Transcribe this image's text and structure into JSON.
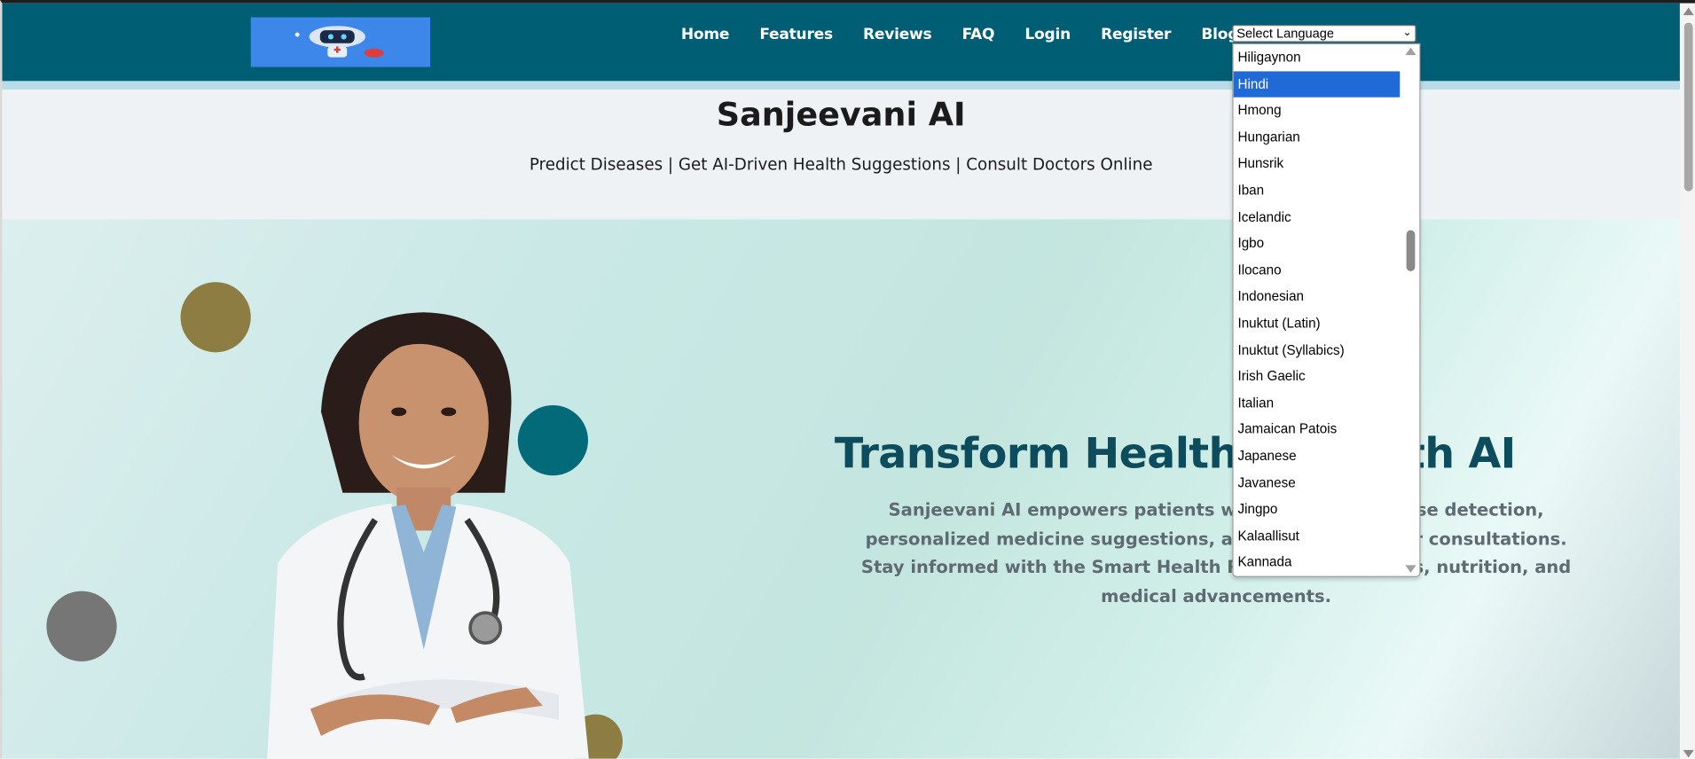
{
  "nav": {
    "links": [
      "Home",
      "Features",
      "Reviews",
      "FAQ",
      "Login",
      "Register",
      "Blogs"
    ],
    "language_select": "Select Language"
  },
  "header": {
    "title": "Sanjeevani AI",
    "tagline": "Predict Diseases | Get AI-Driven Health Suggestions | Consult Doctors Online"
  },
  "hero": {
    "title": "Transform Healthcare with AI",
    "text": "Sanjeevani AI empowers patients with AI-driven disease detection, personalized medicine suggestions, and seamless doctor consultations. Stay informed with the Smart Health Reports on wellness, nutrition, and medical advancements."
  },
  "language_dropdown": {
    "selected": "Hindi",
    "options": [
      "Hiligaynon",
      "Hindi",
      "Hmong",
      "Hungarian",
      "Hunsrik",
      "Iban",
      "Icelandic",
      "Igbo",
      "Ilocano",
      "Indonesian",
      "Inuktut (Latin)",
      "Inuktut (Syllabics)",
      "Irish Gaelic",
      "Italian",
      "Jamaican Patois",
      "Japanese",
      "Javanese",
      "Jingpo",
      "Kalaallisut",
      "Kannada"
    ]
  },
  "colors": {
    "navbar": "#005e74",
    "hero_title": "#0c4c5c",
    "selected_option": "#1f6ad6",
    "circle_gold": "#8e7d42",
    "circle_teal": "#036a7a",
    "circle_gray": "#767676"
  }
}
